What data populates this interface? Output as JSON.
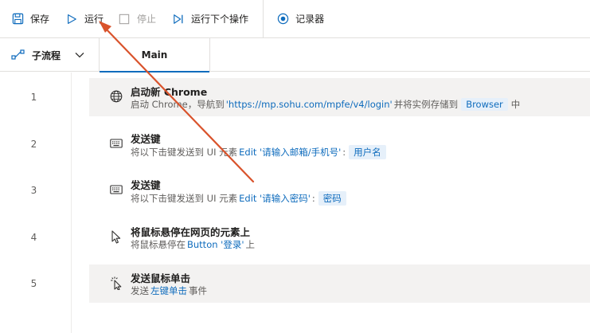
{
  "toolbar": {
    "save_label": "保存",
    "run_label": "运行",
    "stop_label": "停止",
    "run_next_label": "运行下个操作",
    "recorder_label": "记录器"
  },
  "tabs": {
    "subflow_label": "子流程",
    "main_label": "Main"
  },
  "steps": [
    {
      "num": "1",
      "icon": "globe-icon",
      "title": "启动新 Chrome",
      "desc": {
        "p1": "启动 Chrome，导航到 ",
        "url": "'https://mp.sohu.com/mpfe/v4/login'",
        "p2": " 并将实例存储到",
        "var": "Browser",
        "p3": "中"
      }
    },
    {
      "num": "2",
      "icon": "keyboard-icon",
      "title": "发送键",
      "desc": {
        "p1": "将以下击键发送到 UI 元素 ",
        "el": "Edit '请输入邮箱/手机号'",
        "p2": ":",
        "var": "用户名"
      }
    },
    {
      "num": "3",
      "icon": "keyboard-icon",
      "title": "发送键",
      "desc": {
        "p1": "将以下击键发送到 UI 元素 ",
        "el": "Edit '请输入密码'",
        "p2": ":",
        "var": "密码"
      }
    },
    {
      "num": "4",
      "icon": "cursor-icon",
      "title": "将鼠标悬停在网页的元素上",
      "desc": {
        "p1": "将鼠标悬停在 ",
        "el": "Button '登录'",
        "p2": " 上"
      }
    },
    {
      "num": "5",
      "icon": "click-icon",
      "title": "发送鼠标单击",
      "desc": {
        "p1": "发送 ",
        "el": "左键单击",
        "p2": " 事件"
      }
    }
  ],
  "colors": {
    "accent": "#0f6cbd",
    "annotation_arrow": "#d9532c"
  }
}
